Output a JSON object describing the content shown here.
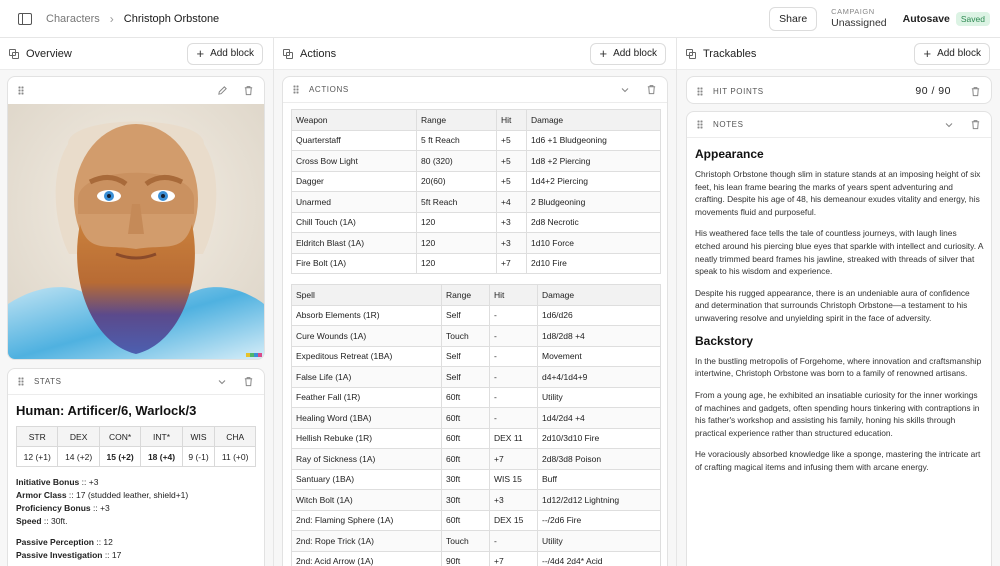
{
  "breadcrumb": {
    "root": "Characters",
    "current": "Christoph Orbstone"
  },
  "top": {
    "share_label": "Share",
    "campaign_label": "CAMPAIGN",
    "campaign_value": "Unassigned",
    "autosave_label": "Autosave",
    "saved_badge": "Saved"
  },
  "columns": {
    "overview": {
      "title": "Overview",
      "add_label": "Add block"
    },
    "actions": {
      "title": "Actions",
      "add_label": "Add block"
    },
    "trackables": {
      "title": "Trackables",
      "add_label": "Add block"
    }
  },
  "stats": {
    "block_title": "STATS",
    "race_class": "Human: Artificer/6, Warlock/3",
    "abilities": [
      {
        "name": "STR",
        "value": "12 (+1)",
        "bold": false
      },
      {
        "name": "DEX",
        "value": "14 (+2)",
        "bold": false
      },
      {
        "name": "CON*",
        "value": "15 (+2)",
        "bold": true
      },
      {
        "name": "INT*",
        "value": "18 (+4)",
        "bold": true
      },
      {
        "name": "WIS",
        "value": "9 (-1)",
        "bold": false
      },
      {
        "name": "CHA",
        "value": "11 (+0)",
        "bold": false
      }
    ],
    "lines": [
      {
        "label": "Initiative Bonus",
        "value": " :: +3"
      },
      {
        "label": "Armor Class",
        "value": " :: 17 (studded leather, shield+1)"
      },
      {
        "label": "Proficiency Bonus",
        "value": " :: +3"
      },
      {
        "label": "Speed",
        "value": " :: 30ft."
      }
    ],
    "passive": [
      {
        "label": "Passive Perception",
        "value": " :: 12"
      },
      {
        "label": "Passive Investigation",
        "value": " :: 17"
      }
    ]
  },
  "actions": {
    "block_title": "ACTIONS",
    "weapon_headers": [
      "Weapon",
      "Range",
      "Hit",
      "Damage"
    ],
    "weapons": [
      [
        "Quarterstaff",
        "5 ft Reach",
        "+5",
        "1d6 +1 Bludgeoning"
      ],
      [
        "Cross Bow Light",
        "80 (320)",
        "+5",
        "1d8 +2 Piercing"
      ],
      [
        "Dagger",
        "20(60)",
        "+5",
        "1d4+2 Piercing"
      ],
      [
        "Unarmed",
        "5ft Reach",
        "+4",
        "2 Bludgeoning"
      ],
      [
        "Chill Touch (1A)",
        "120",
        "+3",
        "2d8 Necrotic"
      ],
      [
        "Eldritch Blast (1A)",
        "120",
        "+3",
        "1d10 Force"
      ],
      [
        "Fire Bolt (1A)",
        "120",
        "+7",
        "2d10 Fire"
      ]
    ],
    "spell_headers": [
      "Spell",
      "Range",
      "Hit",
      "Damage"
    ],
    "spells": [
      [
        "Absorb Elements (1R)",
        "Self",
        "-",
        "1d6/d26"
      ],
      [
        "Cure Wounds (1A)",
        "Touch",
        "-",
        "1d8/2d8 +4"
      ],
      [
        "Expeditous Retreat (1BA)",
        "Self",
        "-",
        "Movement"
      ],
      [
        "False Life (1A)",
        "Self",
        "-",
        "d4+4/1d4+9"
      ],
      [
        "Feather Fall (1R)",
        "60ft",
        "-",
        "Utility"
      ],
      [
        "Healing Word (1BA)",
        "60ft",
        "-",
        "1d4/2d4 +4"
      ],
      [
        "Hellish Rebuke (1R)",
        "60ft",
        "DEX 11",
        "2d10/3d10 Fire"
      ],
      [
        "Ray of Sickness (1A)",
        "60ft",
        "+7",
        "2d8/3d8 Poison"
      ],
      [
        "Santuary (1BA)",
        "30ft",
        "WIS 15",
        "Buff"
      ],
      [
        "Witch Bolt (1A)",
        "30ft",
        "+3",
        "1d12/2d12 Lightning"
      ],
      [
        "2nd: Flaming Sphere (1A)",
        "60ft",
        "DEX 15",
        "--/2d6 Fire"
      ],
      [
        "2nd: Rope Trick (1A)",
        "Touch",
        "-",
        "Utility"
      ],
      [
        "2nd: Acid Arrow (1A)",
        "90ft",
        "+7",
        "--/4d4 2d4* Acid"
      ]
    ]
  },
  "hitpoints": {
    "block_title": "HIT POINTS",
    "value": "90 / 90"
  },
  "notes": {
    "block_title": "NOTES",
    "sections": [
      {
        "heading": "Appearance",
        "paragraphs": [
          "Christoph Orbstone though slim in stature stands at an imposing height of six feet, his lean frame bearing the marks of years spent adventuring and crafting. Despite his age of 48, his demeanour exudes vitality and energy, his movements fluid and purposeful.",
          "His weathered face tells the tale of countless journeys, with laugh lines etched around his piercing blue eyes that sparkle with intellect and curiosity. A neatly trimmed beard frames his jawline, streaked with threads of silver that speak to his wisdom and experience.",
          "Despite his rugged appearance, there is an undeniable aura of confidence and determination that surrounds Christoph Orbstone—a testament to his unwavering resolve and unyielding spirit in the face of adversity."
        ]
      },
      {
        "heading": "Backstory",
        "paragraphs": [
          "In the bustling metropolis of Forgehome, where innovation and craftsmanship intertwine, Christoph Orbstone was born to a family of renowned artisans.",
          "From a young age, he exhibited an insatiable curiosity for the inner workings of machines and gadgets, often spending hours tinkering with contraptions in his father's workshop and assisting his family, honing his skills through practical experience rather than structured education.",
          "He voraciously absorbed knowledge like a sponge, mastering the intricate art of crafting magical items and infusing them with arcane energy."
        ]
      }
    ]
  }
}
